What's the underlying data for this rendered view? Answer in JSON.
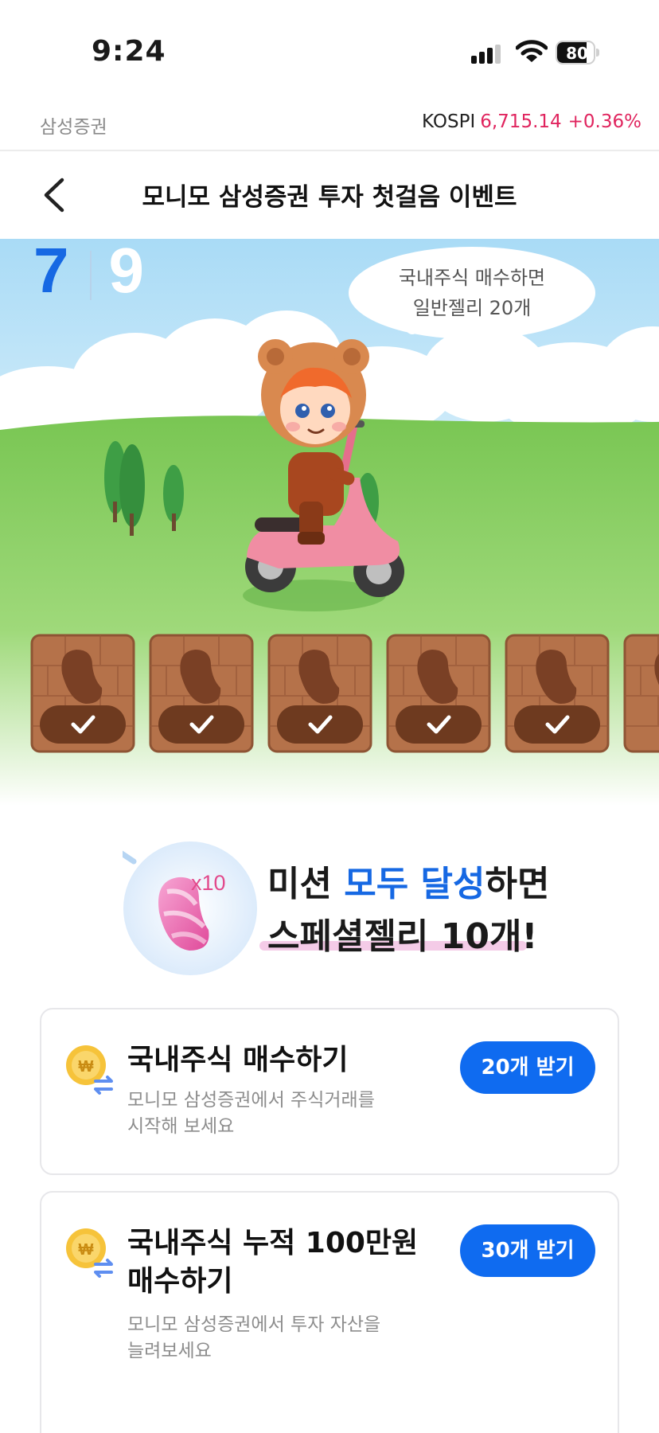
{
  "status_bar": {
    "time": "9:24",
    "battery": "80",
    "battery_level": 0.8
  },
  "top_bar": {
    "brand": "삼성증권",
    "index_name": "KOSPI",
    "index_value": "6,715.14",
    "index_change": "+0.36%"
  },
  "header": {
    "title": "모니모 삼성증권 투자 첫걸음 이벤트"
  },
  "hero": {
    "progress_current": "7",
    "progress_total": "9",
    "bubble_line1": "국내주식 매수하면",
    "bubble_line2": "일반젤리 20개",
    "tiles_completed": 5
  },
  "mission": {
    "multiplier": "x10",
    "line1_prefix": "미션 ",
    "line1_highlight": "모두 달성",
    "line1_suffix": "하면",
    "line2": "스페셜젤리 10개!"
  },
  "tasks": [
    {
      "title": "국내주식 매수하기",
      "desc_line1": "모니모 삼성증권에서 주식거래를",
      "desc_line2": "시작해 보세요",
      "button": "20개 받기"
    },
    {
      "title_line1": "국내주식 누적 100만원",
      "title_line2": "매수하기",
      "desc_line1": "모니모 삼성증권에서 투자 자산을",
      "desc_line2": "늘려보세요",
      "button": "30개 받기"
    }
  ],
  "colors": {
    "accent": "#0f6bf0",
    "index_up": "#e0245e",
    "highlight": "#1668e3",
    "sky": "#bfe4f7",
    "grass": "#7fc95a"
  },
  "icons": {
    "back": "chevron-left-icon",
    "coin": "won-coin-exchange-icon",
    "jelly": "pink-jelly-bean-icon",
    "check": "check-icon"
  }
}
